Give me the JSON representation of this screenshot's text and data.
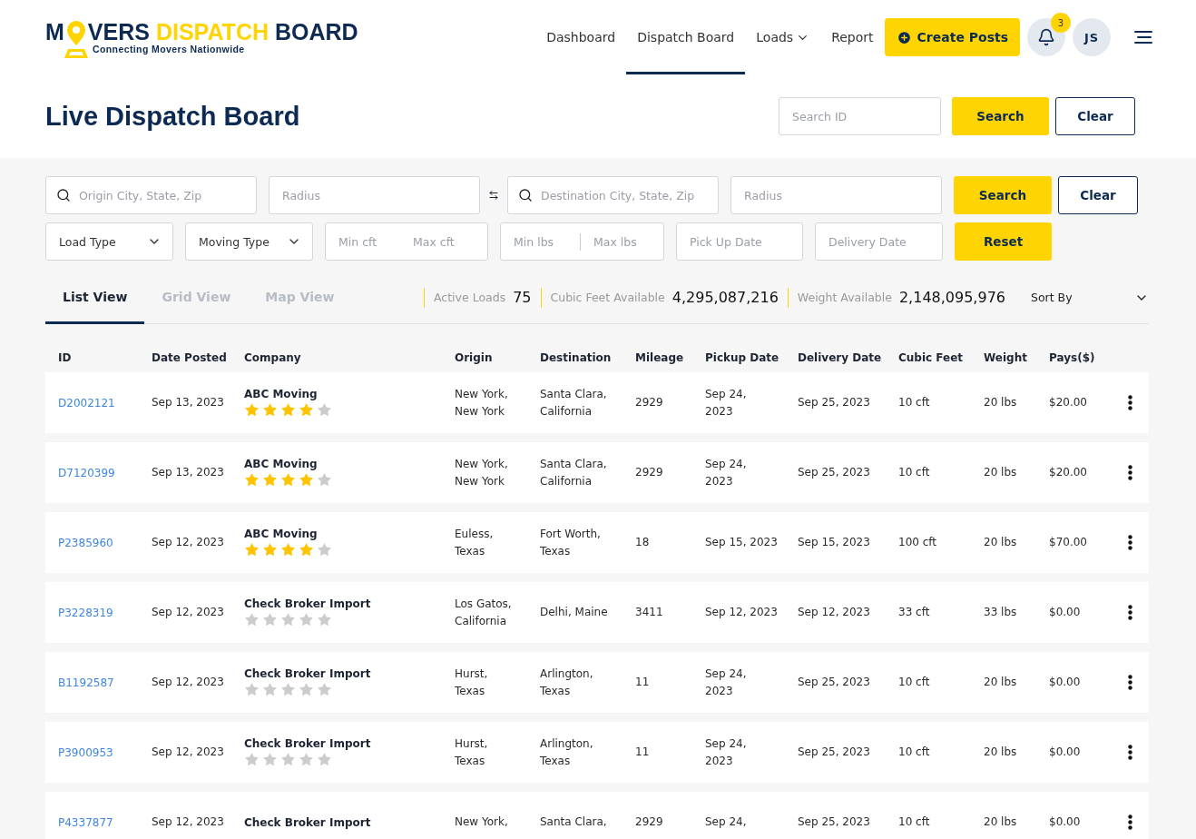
{
  "brand": {
    "title_a": "M",
    "title_b": "VERS",
    "title_c": "DISPATCH",
    "title_d": "BOARD",
    "tagline": "Connecting Movers Nationwide"
  },
  "nav": [
    {
      "label": "Dashboard",
      "selected": false,
      "dropdown": false
    },
    {
      "label": "Dispatch Board",
      "selected": true,
      "dropdown": false
    },
    {
      "label": "Loads",
      "selected": false,
      "dropdown": true
    },
    {
      "label": "Report",
      "selected": false,
      "dropdown": false
    }
  ],
  "create_button": "Create Posts",
  "notifications": "3",
  "avatar": "JS",
  "page_title": "Live Dispatch Board",
  "id_search": {
    "placeholder": "Search ID",
    "search": "Search",
    "clear": "Clear"
  },
  "filters": {
    "origin": {
      "placeholder": "Origin City, State, Zip"
    },
    "origin_radius": {
      "placeholder": "Radius"
    },
    "destination": {
      "placeholder": "Destination City, State, Zip"
    },
    "destination_radius": {
      "placeholder": "Radius"
    },
    "search": "Search",
    "clear": "Clear",
    "load_type": "Load Type",
    "moving_type": "Moving Type",
    "min_cft": {
      "placeholder": "Min cft"
    },
    "max_cft": {
      "placeholder": "Max cft"
    },
    "min_lbs": {
      "placeholder": "Min lbs"
    },
    "max_lbs": {
      "placeholder": "Max lbs"
    },
    "pickup_date": {
      "placeholder": "Pick Up Date"
    },
    "delivery_date": {
      "placeholder": "Delivery Date"
    },
    "reset": "Reset"
  },
  "views": [
    {
      "label": "List View",
      "selected": true
    },
    {
      "label": "Grid View",
      "selected": false
    },
    {
      "label": "Map View",
      "selected": false
    }
  ],
  "stats": [
    {
      "label": "Active Loads",
      "value": "75"
    },
    {
      "label": "Cubic Feet Available",
      "value": "4,295,087,216"
    },
    {
      "label": "Weight Available",
      "value": "2,148,095,976"
    }
  ],
  "sort_by": "Sort By",
  "table": {
    "columns": [
      "ID",
      "Date Posted",
      "Company",
      "Origin",
      "Destination",
      "Mileage",
      "Pickup Date",
      "Delivery Date",
      "Cubic Feet",
      "Weight",
      "Pays($)"
    ],
    "rows": [
      {
        "id": "D2002121",
        "date": "Sep 13, 2023",
        "company": "ABC Moving",
        "stars": 4,
        "origin": [
          "New York,",
          "New York"
        ],
        "destination": [
          "Santa Clara,",
          "California"
        ],
        "mileage": "2929",
        "pickup": [
          "Sep 24,",
          "2023"
        ],
        "delivery": "Sep 25, 2023",
        "cubic": "10 cft",
        "weight": "20 lbs",
        "pays": "$20.00"
      },
      {
        "id": "D7120399",
        "date": "Sep 13, 2023",
        "company": "ABC Moving",
        "stars": 4,
        "origin": [
          "New York,",
          "New York"
        ],
        "destination": [
          "Santa Clara,",
          "California"
        ],
        "mileage": "2929",
        "pickup": [
          "Sep 24,",
          "2023"
        ],
        "delivery": "Sep 25, 2023",
        "cubic": "10 cft",
        "weight": "20 lbs",
        "pays": "$20.00"
      },
      {
        "id": "P2385960",
        "date": "Sep 12, 2023",
        "company": "ABC Moving",
        "stars": 4,
        "origin": [
          "Euless,",
          "Texas"
        ],
        "destination": [
          "Fort Worth,",
          "Texas"
        ],
        "mileage": "18",
        "pickup": [
          "Sep 15, 2023"
        ],
        "delivery": "Sep 15, 2023",
        "cubic": "100 cft",
        "weight": "20 lbs",
        "pays": "$70.00"
      },
      {
        "id": "P3228319",
        "date": "Sep 12, 2023",
        "company": "Check Broker Import",
        "stars": 0,
        "origin": [
          "Los Gatos,",
          "California"
        ],
        "destination": [
          "Delhi, Maine"
        ],
        "mileage": "3411",
        "pickup": [
          "Sep 12, 2023"
        ],
        "delivery": "Sep 12, 2023",
        "cubic": "33 cft",
        "weight": "33 lbs",
        "pays": "$0.00"
      },
      {
        "id": "B1192587",
        "date": "Sep 12, 2023",
        "company": "Check Broker Import",
        "stars": 0,
        "origin": [
          "Hurst,",
          "Texas"
        ],
        "destination": [
          "Arlington,",
          "Texas"
        ],
        "mileage": "11",
        "pickup": [
          "Sep 24,",
          "2023"
        ],
        "delivery": "Sep 25, 2023",
        "cubic": "10 cft",
        "weight": "20 lbs",
        "pays": "$0.00"
      },
      {
        "id": "P3900953",
        "date": "Sep 12, 2023",
        "company": "Check Broker Import",
        "stars": 0,
        "origin": [
          "Hurst,",
          "Texas"
        ],
        "destination": [
          "Arlington,",
          "Texas"
        ],
        "mileage": "11",
        "pickup": [
          "Sep 24,",
          "2023"
        ],
        "delivery": "Sep 25, 2023",
        "cubic": "10 cft",
        "weight": "20 lbs",
        "pays": "$0.00"
      },
      {
        "id": "P4337877",
        "date": "Sep 12, 2023",
        "company": "Check Broker Import",
        "origin": [
          "New York,"
        ],
        "destination": [
          "Santa Clara,"
        ],
        "mileage": "2929",
        "pickup": [
          "Sep 24,"
        ],
        "delivery": "Sep 25, 2023",
        "cubic": "10 cft",
        "weight": "20 lbs",
        "pays": "$0.00"
      }
    ]
  }
}
